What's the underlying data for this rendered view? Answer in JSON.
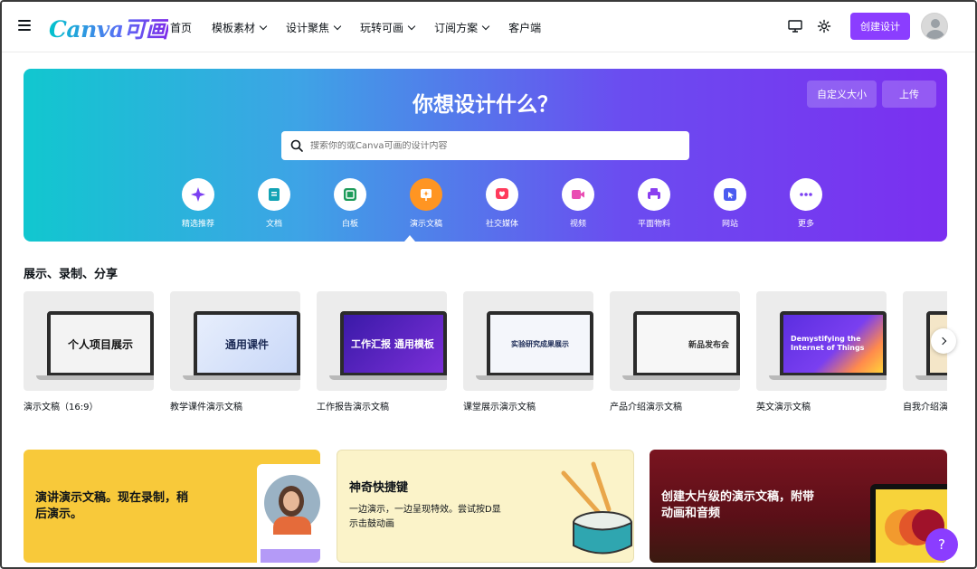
{
  "nav": {
    "logo": "Canva可画",
    "items": [
      {
        "label": "首页",
        "dropdown": false
      },
      {
        "label": "模板素材",
        "dropdown": true
      },
      {
        "label": "设计聚焦",
        "dropdown": true
      },
      {
        "label": "玩转可画",
        "dropdown": true
      },
      {
        "label": "订阅方案",
        "dropdown": true
      },
      {
        "label": "客户端",
        "dropdown": false
      }
    ],
    "create_label": "创建设计",
    "icons": [
      "hamburger-icon",
      "monitor-icon",
      "gear-icon",
      "avatar"
    ]
  },
  "hero": {
    "title": "你想设计什么？",
    "custom_size": "自定义大小",
    "upload": "上传",
    "search_placeholder": "搜索你的或Canva可画的设计内容",
    "categories": [
      {
        "label": "精选推荐",
        "icon": "sparkle-icon",
        "color": "#7b3ff2"
      },
      {
        "label": "文档",
        "icon": "document-icon",
        "color": "#13a3b5"
      },
      {
        "label": "白板",
        "icon": "whiteboard-icon",
        "color": "#1e9b5a"
      },
      {
        "label": "演示文稿",
        "icon": "presentation-icon",
        "color": "#ff9522",
        "active": true
      },
      {
        "label": "社交媒体",
        "icon": "heart-icon",
        "color": "#ff3b5c"
      },
      {
        "label": "视频",
        "icon": "video-icon",
        "color": "#e94db3"
      },
      {
        "label": "平面物料",
        "icon": "print-icon",
        "color": "#8a3ff0"
      },
      {
        "label": "网站",
        "icon": "cursor-icon",
        "color": "#4a5bf0"
      },
      {
        "label": "更多",
        "icon": "more-icon",
        "color": "#7b3ff2"
      }
    ]
  },
  "section": {
    "title": "展示、录制、分享",
    "templates": [
      {
        "label": "演示文稿（16:9）",
        "screen": "个人项目展示"
      },
      {
        "label": "教学课件演示文稿",
        "screen": "通用课件"
      },
      {
        "label": "工作报告演示文稿",
        "screen": "工作汇报 通用模板"
      },
      {
        "label": "课堂展示演示文稿",
        "screen": "实验研究成果展示"
      },
      {
        "label": "产品介绍演示文稿",
        "screen": "新品发布会"
      },
      {
        "label": "英文演示文稿",
        "screen": "Demystifying the Internet of Things"
      },
      {
        "label": "自我介绍演",
        "screen": ""
      }
    ]
  },
  "promos": [
    {
      "title": "演讲演示文稿。现在录制，稍后演示。"
    },
    {
      "title": "神奇快捷键",
      "sub": "一边演示，一边呈现特效。尝试按D显示击鼓动画"
    },
    {
      "title": "创建大片级的演示文稿，附带动画和音频"
    }
  ],
  "help_label": "?",
  "colors": {
    "accent": "#8b3dff",
    "hero_start": "#11c7cf",
    "hero_end": "#7b2ff0"
  }
}
